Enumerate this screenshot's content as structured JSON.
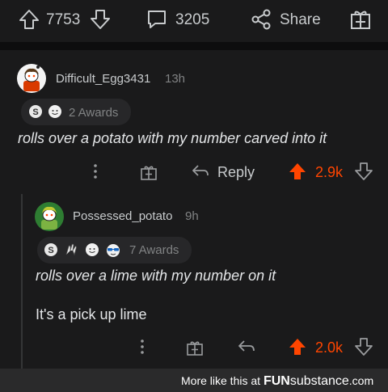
{
  "post_actions": {
    "upvotes": "7753",
    "comments": "3205",
    "share_label": "Share"
  },
  "comment1": {
    "username": "Difficult_Egg3431",
    "time": "13h",
    "awards_label": "2 Awards",
    "body": "rolls over a potato with my number carved into it",
    "reply_label": "Reply",
    "score": "2.9k"
  },
  "comment2": {
    "username": "Possessed_potato",
    "time": "9h",
    "awards_label": "7 Awards",
    "body_line1": "rolls over a lime with my number on it",
    "body_line2": "It's a pick up lime",
    "score": "2.0k"
  },
  "footer": {
    "prefix": "More like this at",
    "brand_fun": "FUN",
    "brand_sub": "substance",
    "brand_tld": ".com"
  },
  "colors": {
    "background": "#1a1a1b",
    "upvote_active": "#ff4500",
    "text": "#d7dadc"
  }
}
